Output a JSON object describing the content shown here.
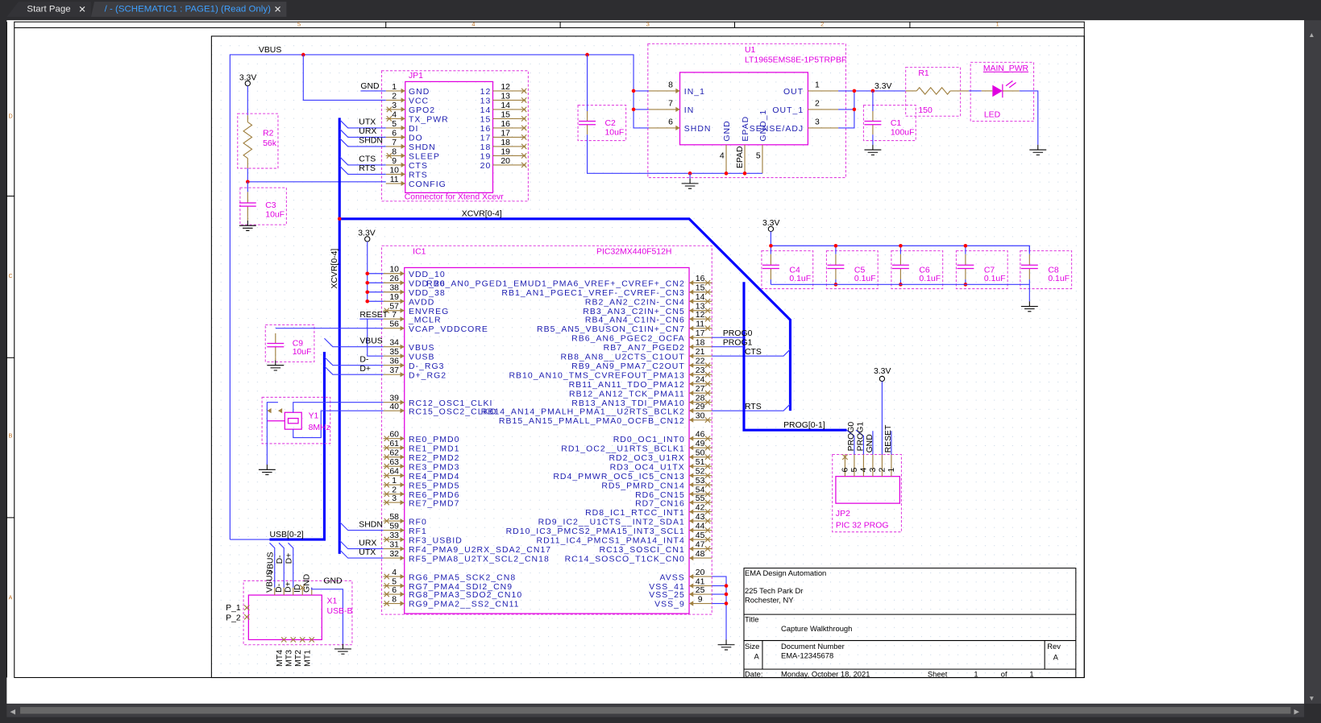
{
  "tabs": [
    {
      "label": "Start Page",
      "active": false
    },
    {
      "label": "/ - (SCHEMATIC1 : PAGE1) (Read Only)",
      "active": true
    }
  ],
  "border": {
    "columns": [
      "5",
      "4",
      "3",
      "2",
      "1"
    ],
    "rows": [
      "D",
      "C",
      "B",
      "A"
    ]
  },
  "colors": {
    "wire": "#3b3bff",
    "bus": "#0000ff",
    "part": "#e000e0",
    "pin": "#a08040",
    "pin_text": "#1c1cb0",
    "junction": "#ff0000",
    "tab_active_text": "#3fa0ff",
    "canvas": "#ffffff"
  },
  "nets": {
    "vbus": "VBUS",
    "gnd": "GND",
    "utx": "UTX",
    "urx": "URX",
    "shdn": "SHDN",
    "cts": "CTS",
    "rts": "RTS",
    "xcvr": "XCVR[0-4]",
    "usb": "USB[0-2]",
    "prog": "PROG[0-1]",
    "prog0": "PROG0",
    "prog1": "PROG1",
    "reset": "RESET",
    "dminus": "D-",
    "dplus": "D+",
    "v33": "3.3V"
  },
  "ic1": {
    "ref": "IC1",
    "part": "PIC32MX440F512H",
    "left": [
      {
        "num": "10",
        "name": "VDD_10"
      },
      {
        "num": "26",
        "name": "VDD_26"
      },
      {
        "num": "38",
        "name": "VDD_38"
      },
      {
        "num": "19",
        "name": "AVDD"
      },
      {
        "num": "57",
        "name": "ENVREG",
        "nc": true
      },
      {
        "num": "7",
        "name": "_MCLR"
      },
      {
        "num": "56",
        "name": "VCAP_VDDCORE"
      },
      {
        "num": "34",
        "name": "VBUS"
      },
      {
        "num": "35",
        "name": "VUSB"
      },
      {
        "num": "36",
        "name": "D-_RG3"
      },
      {
        "num": "37",
        "name": "D+_RG2"
      },
      {
        "num": "39",
        "name": "RC12_OSC1_CLKI"
      },
      {
        "num": "40",
        "name": "RC15_OSC2_CLKO"
      },
      {
        "num": "60",
        "name": "RE0_PMD0",
        "nc": true
      },
      {
        "num": "61",
        "name": "RE1_PMD1",
        "nc": true
      },
      {
        "num": "62",
        "name": "RE2_PMD2",
        "nc": true
      },
      {
        "num": "63",
        "name": "RE3_PMD3",
        "nc": true
      },
      {
        "num": "64",
        "name": "RE4_PMD4",
        "nc": true
      },
      {
        "num": "1",
        "name": "RE5_PMD5",
        "nc": true
      },
      {
        "num": "2",
        "name": "RE6_PMD6",
        "nc": true
      },
      {
        "num": "3",
        "name": "RE7_PMD7",
        "nc": true
      },
      {
        "num": "58",
        "name": "RF0",
        "nc": true
      },
      {
        "num": "59",
        "name": "RF1"
      },
      {
        "num": "33",
        "name": "RF3_USBID",
        "nc": true
      },
      {
        "num": "31",
        "name": "RF4_PMA9_U2RX_SDA2_CN17"
      },
      {
        "num": "32",
        "name": "RF5_PMA8_U2TX_SCL2_CN18"
      },
      {
        "num": "4",
        "name": "RG6_PMA5_SCK2_CN8",
        "nc": true
      },
      {
        "num": "5",
        "name": "RG7_PMA4_SDI2_CN9",
        "nc": true
      },
      {
        "num": "6",
        "name": "RG8_PMA3_SDO2_CN10",
        "nc": true
      },
      {
        "num": "8",
        "name": "RG9_PMA2__SS2_CN11",
        "nc": true
      }
    ],
    "right": [
      {
        "num": "16",
        "name": "RB0_AN0_PGED1_EMUD1_PMA6_VREF+_CVREF+_CN2",
        "nc": true
      },
      {
        "num": "15",
        "name": "RB1_AN1_PGEC1_VREF-_CVREF-_CN3",
        "nc": true
      },
      {
        "num": "14",
        "name": "RB2_AN2_C2IN-_CN4",
        "nc": true
      },
      {
        "num": "13",
        "name": "RB3_AN3_C2IN+_CN5",
        "nc": true
      },
      {
        "num": "12",
        "name": "RB4_AN4_C1IN-_CN6",
        "nc": true
      },
      {
        "num": "11",
        "name": "RB5_AN5_VBUSON_C1IN+_CN7",
        "nc": true
      },
      {
        "num": "17",
        "name": "RB6_AN6_PGEC2_OCFA"
      },
      {
        "num": "18",
        "name": "RB7_AN7_PGED2"
      },
      {
        "num": "21",
        "name": "RB8_AN8__U2CTS_C1OUT"
      },
      {
        "num": "22",
        "name": "RB9_AN9_PMA7_C2OUT",
        "nc": true
      },
      {
        "num": "23",
        "name": "RB10_AN10_TMS_CVREFOUT_PMA13",
        "nc": true
      },
      {
        "num": "24",
        "name": "RB11_AN11_TDO_PMA12",
        "nc": true
      },
      {
        "num": "27",
        "name": "RB12_AN12_TCK_PMA11",
        "nc": true
      },
      {
        "num": "28",
        "name": "RB13_AN13_TDI_PMA10",
        "nc": true
      },
      {
        "num": "29",
        "name": "RB14_AN14_PMALH_PMA1__U2RTS_BCLK2"
      },
      {
        "num": "30",
        "name": "RB15_AN15_PMALL_PMA0_OCFB_CN12",
        "nc": true
      },
      {
        "num": "46",
        "name": "RD0_OC1_INT0",
        "nc": true
      },
      {
        "num": "49",
        "name": "RD1_OC2__U1RTS_BCLK1",
        "nc": true
      },
      {
        "num": "50",
        "name": "RD2_OC3_U1RX",
        "nc": true
      },
      {
        "num": "51",
        "name": "RD3_OC4_U1TX",
        "nc": true
      },
      {
        "num": "52",
        "name": "RD4_PMWR_OC5_IC5_CN13",
        "nc": true
      },
      {
        "num": "53",
        "name": "RD5_PMRD_CN14",
        "nc": true
      },
      {
        "num": "54",
        "name": "RD6_CN15",
        "nc": true
      },
      {
        "num": "55",
        "name": "RD7_CN16",
        "nc": true
      },
      {
        "num": "42",
        "name": "RD8_IC1_RTCC_INT1",
        "nc": true
      },
      {
        "num": "43",
        "name": "RD9_IC2__U1CTS__INT2_SDA1",
        "nc": true
      },
      {
        "num": "44",
        "name": "RD10_IC3_PMCS2_PMA15_INT3_SCL1",
        "nc": true
      },
      {
        "num": "45",
        "name": "RD11_IC4_PMCS1_PMA14_INT4",
        "nc": true
      },
      {
        "num": "47",
        "name": "RC13_SOSCI_CN1",
        "nc": true
      },
      {
        "num": "48",
        "name": "RC14_SOSCO_T1CK_CN0"
      },
      {
        "num": "20",
        "name": "AVSS"
      },
      {
        "num": "41",
        "name": "VSS_41"
      },
      {
        "num": "25",
        "name": "VSS_25"
      },
      {
        "num": "9",
        "name": "VSS_9"
      }
    ]
  },
  "jp1": {
    "ref": "JP1",
    "desc": "Connector for Xtend Xcevr",
    "left": [
      {
        "num": "1",
        "name": "GND"
      },
      {
        "num": "2",
        "name": "VCC"
      },
      {
        "num": "3",
        "name": "GPO2",
        "nc": true
      },
      {
        "num": "4",
        "name": "TX_PWR",
        "nc": true
      },
      {
        "num": "5",
        "name": "DI"
      },
      {
        "num": "6",
        "name": "DO"
      },
      {
        "num": "7",
        "name": "SHDN"
      },
      {
        "num": "8",
        "name": "SLEEP",
        "nc": true
      },
      {
        "num": "9",
        "name": "CTS"
      },
      {
        "num": "10",
        "name": "RTS"
      },
      {
        "num": "11",
        "name": "CONFIG"
      }
    ],
    "right": [
      {
        "num": "12",
        "name": "12",
        "nc": true
      },
      {
        "num": "13",
        "name": "13",
        "nc": true
      },
      {
        "num": "14",
        "name": "14",
        "nc": true
      },
      {
        "num": "15",
        "name": "15",
        "nc": true
      },
      {
        "num": "16",
        "name": "16",
        "nc": true
      },
      {
        "num": "17",
        "name": "17",
        "nc": true
      },
      {
        "num": "18",
        "name": "18",
        "nc": true
      },
      {
        "num": "19",
        "name": "19",
        "nc": true
      },
      {
        "num": "20",
        "name": "20",
        "nc": true
      }
    ]
  },
  "u1": {
    "ref": "U1",
    "part": "LT1965EMS8E-1P5TRPBF",
    "left": [
      {
        "num": "8",
        "name": "IN_1"
      },
      {
        "num": "7",
        "name": "IN"
      },
      {
        "num": "6",
        "name": "SHDN"
      }
    ],
    "right": [
      {
        "num": "1",
        "name": "OUT"
      },
      {
        "num": "2",
        "name": "OUT_1"
      },
      {
        "num": "3",
        "name": "SENSE/ADJ"
      }
    ],
    "bottom": [
      {
        "num": "4",
        "name": "GND"
      },
      {
        "num": "EPAD",
        "name": "EPAD"
      },
      {
        "num": "5",
        "name": "GND_1"
      }
    ]
  },
  "parts": {
    "R1": {
      "ref": "R1",
      "value": "150"
    },
    "R2": {
      "ref": "R2",
      "value": "56k"
    },
    "C1": {
      "ref": "C1",
      "value": "100uF"
    },
    "C2": {
      "ref": "C2",
      "value": "10uF"
    },
    "C3": {
      "ref": "C3",
      "value": "10uF"
    },
    "C4": {
      "ref": "C4",
      "value": "0.1uF"
    },
    "C5": {
      "ref": "C5",
      "value": "0.1uF"
    },
    "C6": {
      "ref": "C6",
      "value": "0.1uF"
    },
    "C7": {
      "ref": "C7",
      "value": "0.1uF"
    },
    "C8": {
      "ref": "C8",
      "value": "0.1uF"
    },
    "C9": {
      "ref": "C9",
      "value": "10uF"
    },
    "Y1": {
      "ref": "Y1",
      "value": "8MHz"
    }
  },
  "led": {
    "ref": "MAIN_PWR",
    "value": "LED"
  },
  "jp2": {
    "ref": "JP2",
    "desc": "PIC 32 PROG",
    "pins": [
      "6",
      "5",
      "4",
      "3",
      "2",
      "1"
    ]
  },
  "x1": {
    "ref": "X1",
    "part": "USB-B",
    "top": [
      "VBUS",
      "D-",
      "D+",
      "ID",
      "GND"
    ],
    "side": [
      "P_1",
      "P_2"
    ],
    "bottom": [
      "MT4",
      "MT3",
      "MT2",
      "MT1"
    ]
  },
  "title_block": {
    "company": "EMA Design Automation",
    "address1": "225 Tech Park Dr",
    "address2": "Rochester, NY",
    "title_label": "Title",
    "title": "Capture Walkthrough",
    "size_label": "Size",
    "size": "A",
    "docnum_label": "Document Number",
    "docnum": "EMA-12345678",
    "rev_label": "Rev",
    "rev": "A",
    "date_label": "Date:",
    "date": "Monday, October 18, 2021",
    "sheet_label": "Sheet",
    "sheet": "1",
    "of_label": "of",
    "sheets": "1"
  }
}
